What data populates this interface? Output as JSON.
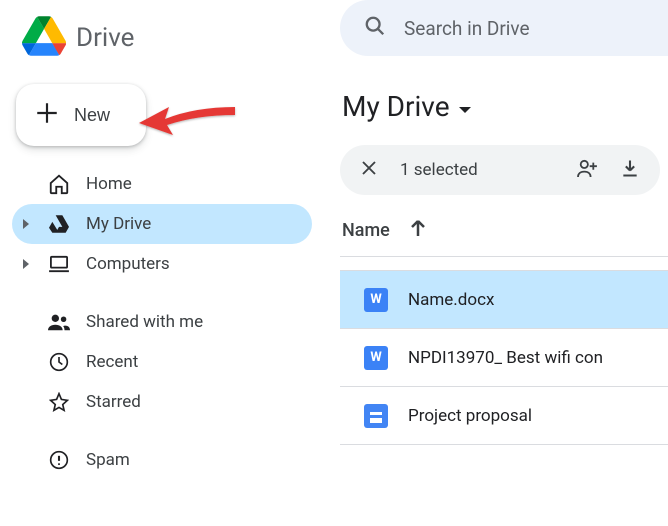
{
  "brand": {
    "title": "Drive"
  },
  "new_button": {
    "label": "New"
  },
  "nav": {
    "home": "Home",
    "my_drive": "My Drive",
    "computers": "Computers",
    "shared": "Shared with me",
    "recent": "Recent",
    "starred": "Starred",
    "spam": "Spam"
  },
  "search": {
    "placeholder": "Search in Drive"
  },
  "page": {
    "title": "My Drive"
  },
  "selection": {
    "count_text": "1 selected"
  },
  "columns": {
    "name": "Name"
  },
  "files": [
    {
      "name": "Name.docx",
      "type": "word"
    },
    {
      "name": "NPDI13970_ Best wifi con",
      "type": "word"
    },
    {
      "name": "Project proposal",
      "type": "gdoc"
    }
  ]
}
